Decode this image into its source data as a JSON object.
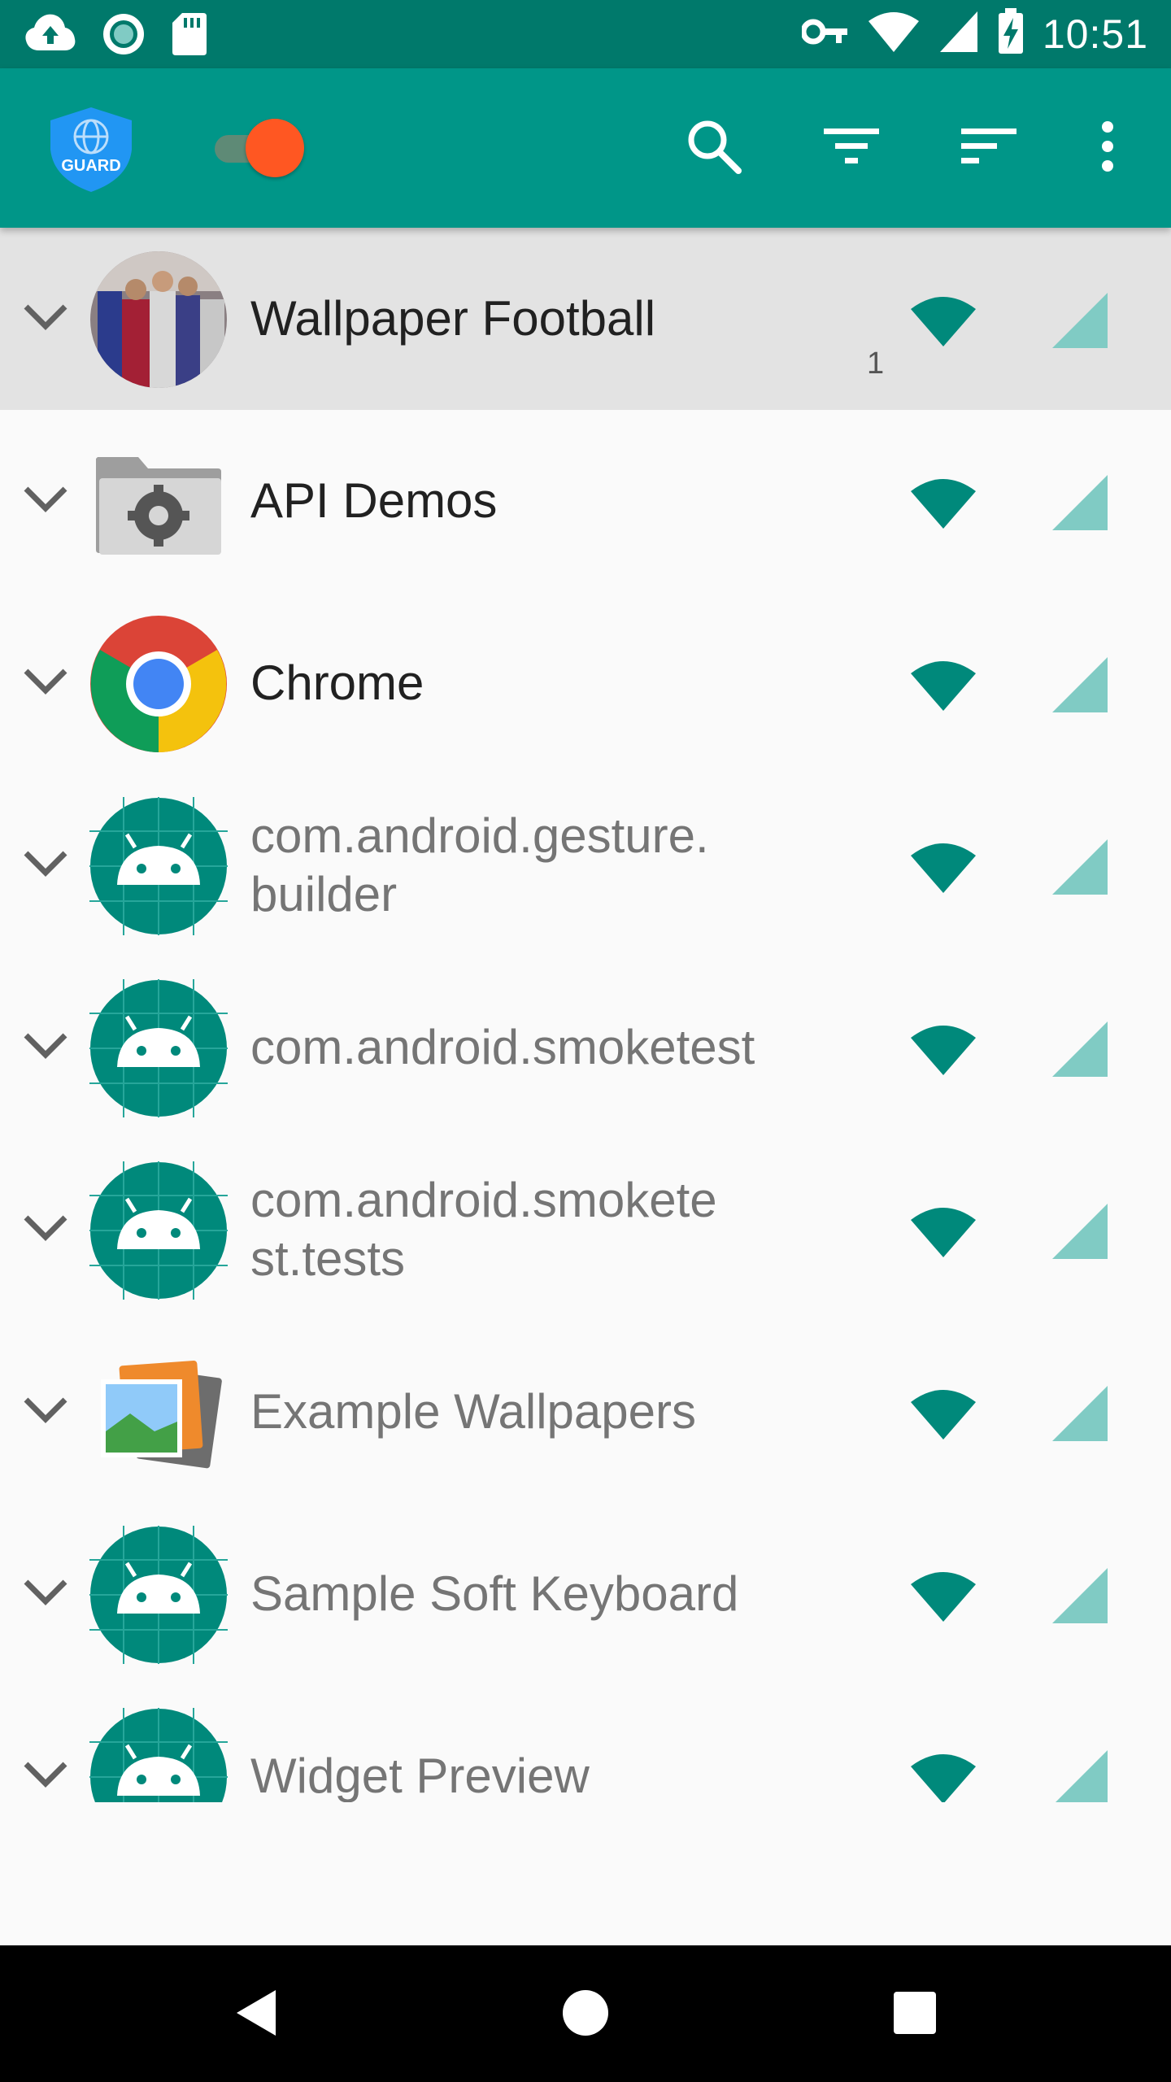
{
  "status_bar": {
    "time": "10:51",
    "icons": [
      "cloud-upload-icon",
      "sync-circle-icon",
      "sd-card-icon",
      "vpn-key-icon",
      "wifi-icon",
      "cell-signal-icon",
      "battery-charging-icon"
    ]
  },
  "app_bar": {
    "logo_text": "GUARD",
    "master_switch_on": true,
    "actions": [
      "search-icon",
      "filter-icon",
      "sort-icon",
      "more-vert-icon"
    ]
  },
  "apps": [
    {
      "name": "Wallpaper Football",
      "badge": "1",
      "system": false,
      "selected": true,
      "icon": "football-photo-icon"
    },
    {
      "name": "API Demos",
      "badge": "",
      "system": false,
      "selected": false,
      "icon": "settings-folder-icon"
    },
    {
      "name": "Chrome",
      "badge": "",
      "system": false,
      "selected": false,
      "icon": "chrome-icon"
    },
    {
      "name": "com.android.gesture.\nbuilder",
      "badge": "",
      "system": true,
      "selected": false,
      "icon": "android-icon"
    },
    {
      "name": "com.android.smoketest",
      "badge": "",
      "system": true,
      "selected": false,
      "icon": "android-icon"
    },
    {
      "name": "com.android.smokete\nst.tests",
      "badge": "",
      "system": true,
      "selected": false,
      "icon": "android-icon"
    },
    {
      "name": "Example Wallpapers",
      "badge": "",
      "system": true,
      "selected": false,
      "icon": "wallpapers-icon"
    },
    {
      "name": "Sample Soft Keyboard",
      "badge": "",
      "system": true,
      "selected": false,
      "icon": "android-icon"
    },
    {
      "name": "Widget Preview",
      "badge": "",
      "system": true,
      "selected": false,
      "icon": "android-icon"
    }
  ],
  "colors": {
    "primary": "#009688",
    "primary_dark": "#00796b",
    "accent": "#ff5722",
    "wifi_allowed": "#00897b",
    "cell_allowed": "#80cbc4"
  },
  "nav_bar": [
    "back-icon",
    "home-icon",
    "recents-icon"
  ]
}
